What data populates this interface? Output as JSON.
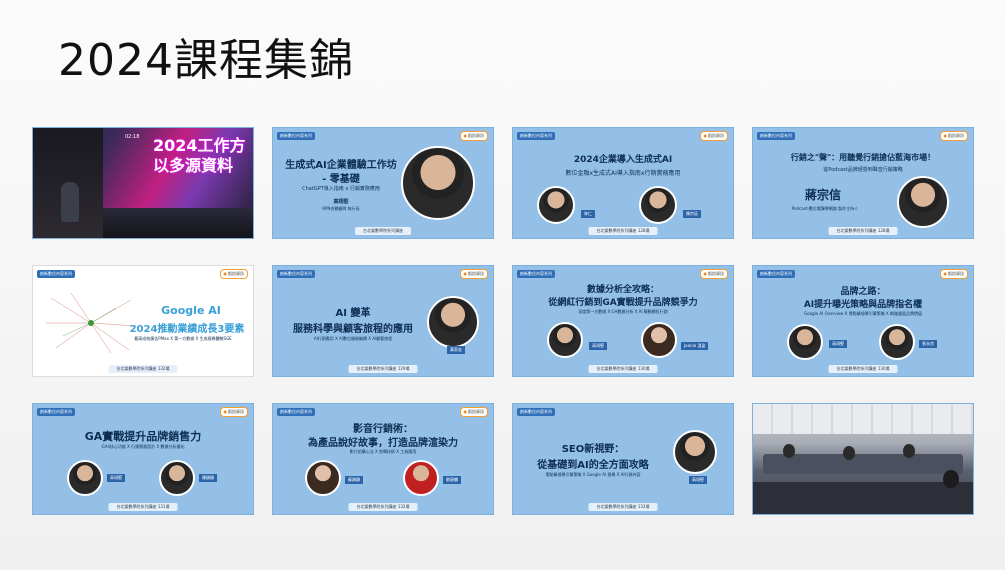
{
  "slide": {
    "title": "2024課程集錦"
  },
  "tiles": [
    {
      "kind": "photo",
      "screen_text_1": "2024工作方",
      "screen_text_2": "以多源資料",
      "clock": "02:18"
    },
    {
      "tag": "創新數位內容系列",
      "brand": "凱鈞資訊",
      "title": "生成式AI企業體驗工作坊",
      "title2": "- 零基礎",
      "subtitle": "ChatGPT導入指南 x 行銷實務應用",
      "speaker": "高翊堅",
      "role": "KPN合夥顧問 執行長",
      "footer": "台北榮數學院系列講座"
    },
    {
      "tag": "創新數位內容系列",
      "brand": "凱鈞資訊",
      "title": "2024企業導入生成式AI",
      "subtitle": "數位金融x生成式AI導入指南x行銷實務應用",
      "speaker1": "林仁",
      "speaker2": "陳宗廷",
      "footer": "台北榮數學院系列講座 128場"
    },
    {
      "tag": "創新數位內容系列",
      "brand": "凱鈞資訊",
      "title": "行銷之\"聲\"：用聽覺行銷搶佔藍海市場！",
      "subtitle": "從Podcast品牌經營到聲音行銷策略",
      "speaker": "蔣宗信",
      "role": "Podcast-數位電獨學網路 製作主持人",
      "footer": "台北榮數學院系列講座 128場"
    },
    {
      "tag": "創新數位內容系列",
      "brand": "凱鈞資訊",
      "title": "Google AI",
      "title2": "2024推動業績成長3要素",
      "subtitle": "最高成效廣告PMax X 第一方數據 X 生成搜尋體驗SGE",
      "footer": "台北榮數學院系列講座 132場"
    },
    {
      "tag": "創新數位內容系列",
      "brand": "凱鈞資訊",
      "title": "AI 變革",
      "title2": "服務科學與顧客旅程的應用",
      "subtitle": "AI行銷應用 X AI數位服務編輯 X AI顧客旅程",
      "speaker": "黃家宏",
      "footer": "台北榮數學院系列講座 129場"
    },
    {
      "tag": "創新數位內容系列",
      "brand": "凱鈞資訊",
      "title": "數據分析全攻略：",
      "title2": "從網紅行銷到GA實戰提升品牌競爭力",
      "subtitle": "深度第一方數據 X GA數據分析 X AI 驅動網紅行銷",
      "speaker1": "高翊堅",
      "speaker2": "Jeanie 溫盈",
      "footer": "台北榮數學院系列講座 130場"
    },
    {
      "tag": "創新數位內容系列",
      "brand": "凱鈞資訊",
      "title": "品牌之路：",
      "title2": "AI提升曝光策略與品牌指名權",
      "subtitle": "Google AI Overview X 零點擊搜尋引擎策略 X 網路聲量品牌價值",
      "speaker1": "高翊堅",
      "speaker2": "張永良",
      "footer": "台北榮數學院系列講座 130場"
    },
    {
      "tag": "創新數位內容系列",
      "brand": "凱鈞資訊",
      "title": "GA實戰提升品牌銷售力",
      "subtitle": "GA4核心功能 X 行銷實務設計 X 數據分析優化",
      "speaker1": "高翊堅",
      "speaker2": "陳穎穎",
      "footer": "台北榮數學院系列講座 131場"
    },
    {
      "tag": "創新數位內容系列",
      "brand": "凱鈞資訊",
      "title": "影音行銷術：",
      "title2": "為產品說好故事，打造品牌渲染力",
      "subtitle": "影片拍攝心法 X 剪輯技術 X 工具應用",
      "speaker1": "蘇穎穎",
      "speaker2": "劉豪麟",
      "footer": "台北榮數學院系列講座 132場"
    },
    {
      "tag": "創新數位內容系列",
      "title": "SEO新視野：",
      "title2": "從基礎到AI的全方面攻略",
      "subtitle": "零點擊搜尋引擎策略 X Google AI 搜尋 X AI行銷內容",
      "speaker": "高翊堅",
      "footer": "台北榮數學院系列講座 133場"
    },
    {
      "kind": "photo-room"
    }
  ]
}
